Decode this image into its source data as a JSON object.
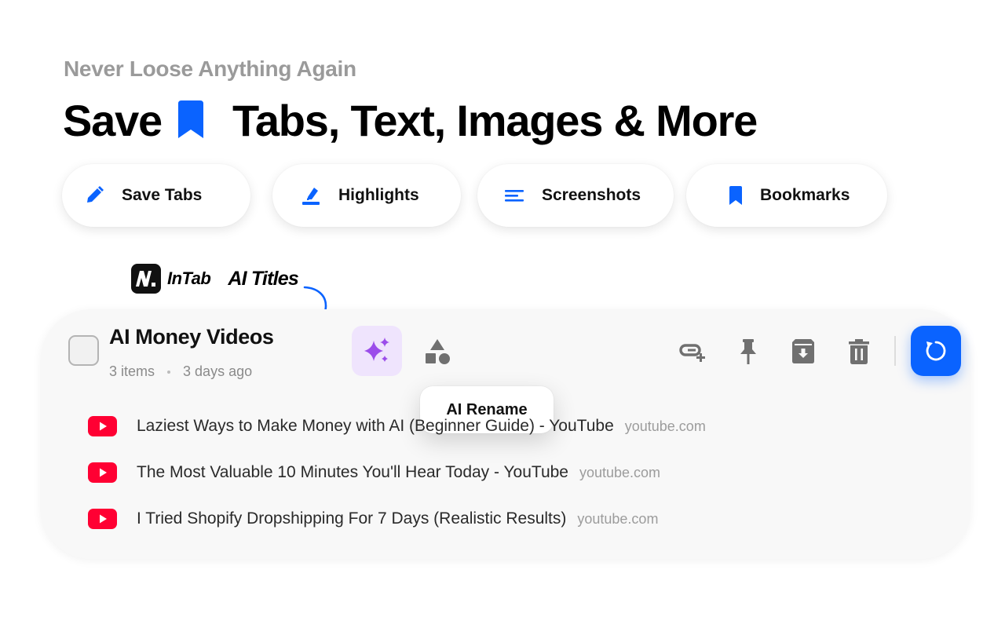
{
  "header": {
    "tagline": "Never Loose Anything Again",
    "headline_start": "Save",
    "headline_rest": "Tabs, Text, Images & More"
  },
  "feature_pills": [
    {
      "label": "Save Tabs",
      "icon": "pencil-icon"
    },
    {
      "label": "Highlights",
      "icon": "highlighter-icon"
    },
    {
      "label": "Screenshots",
      "icon": "lines-icon"
    },
    {
      "label": "Bookmarks",
      "icon": "bookmark-icon"
    }
  ],
  "brand": {
    "logo_letter": "N",
    "name": "InTab",
    "feature_label": "AI Titles"
  },
  "group": {
    "title": "AI Money Videos",
    "item_count": "3 items",
    "updated": "3 days ago",
    "tooltip": "AI Rename",
    "tabs": [
      {
        "title": "Laziest Ways to Make Money with AI (Beginner Guide) - YouTube",
        "domain": "youtube.com"
      },
      {
        "title": "The Most Valuable 10 Minutes You'll Hear Today - YouTube",
        "domain": "youtube.com"
      },
      {
        "title": "I Tried Shopify Dropshipping For 7 Days (Realistic Results)",
        "domain": "youtube.com"
      }
    ]
  },
  "colors": {
    "accent_blue": "#0a63ff",
    "ai_purple": "#9b4dea",
    "ai_purple_bg": "#efe4fd",
    "youtube_red": "#ff0033",
    "icon_gray": "#707070"
  }
}
